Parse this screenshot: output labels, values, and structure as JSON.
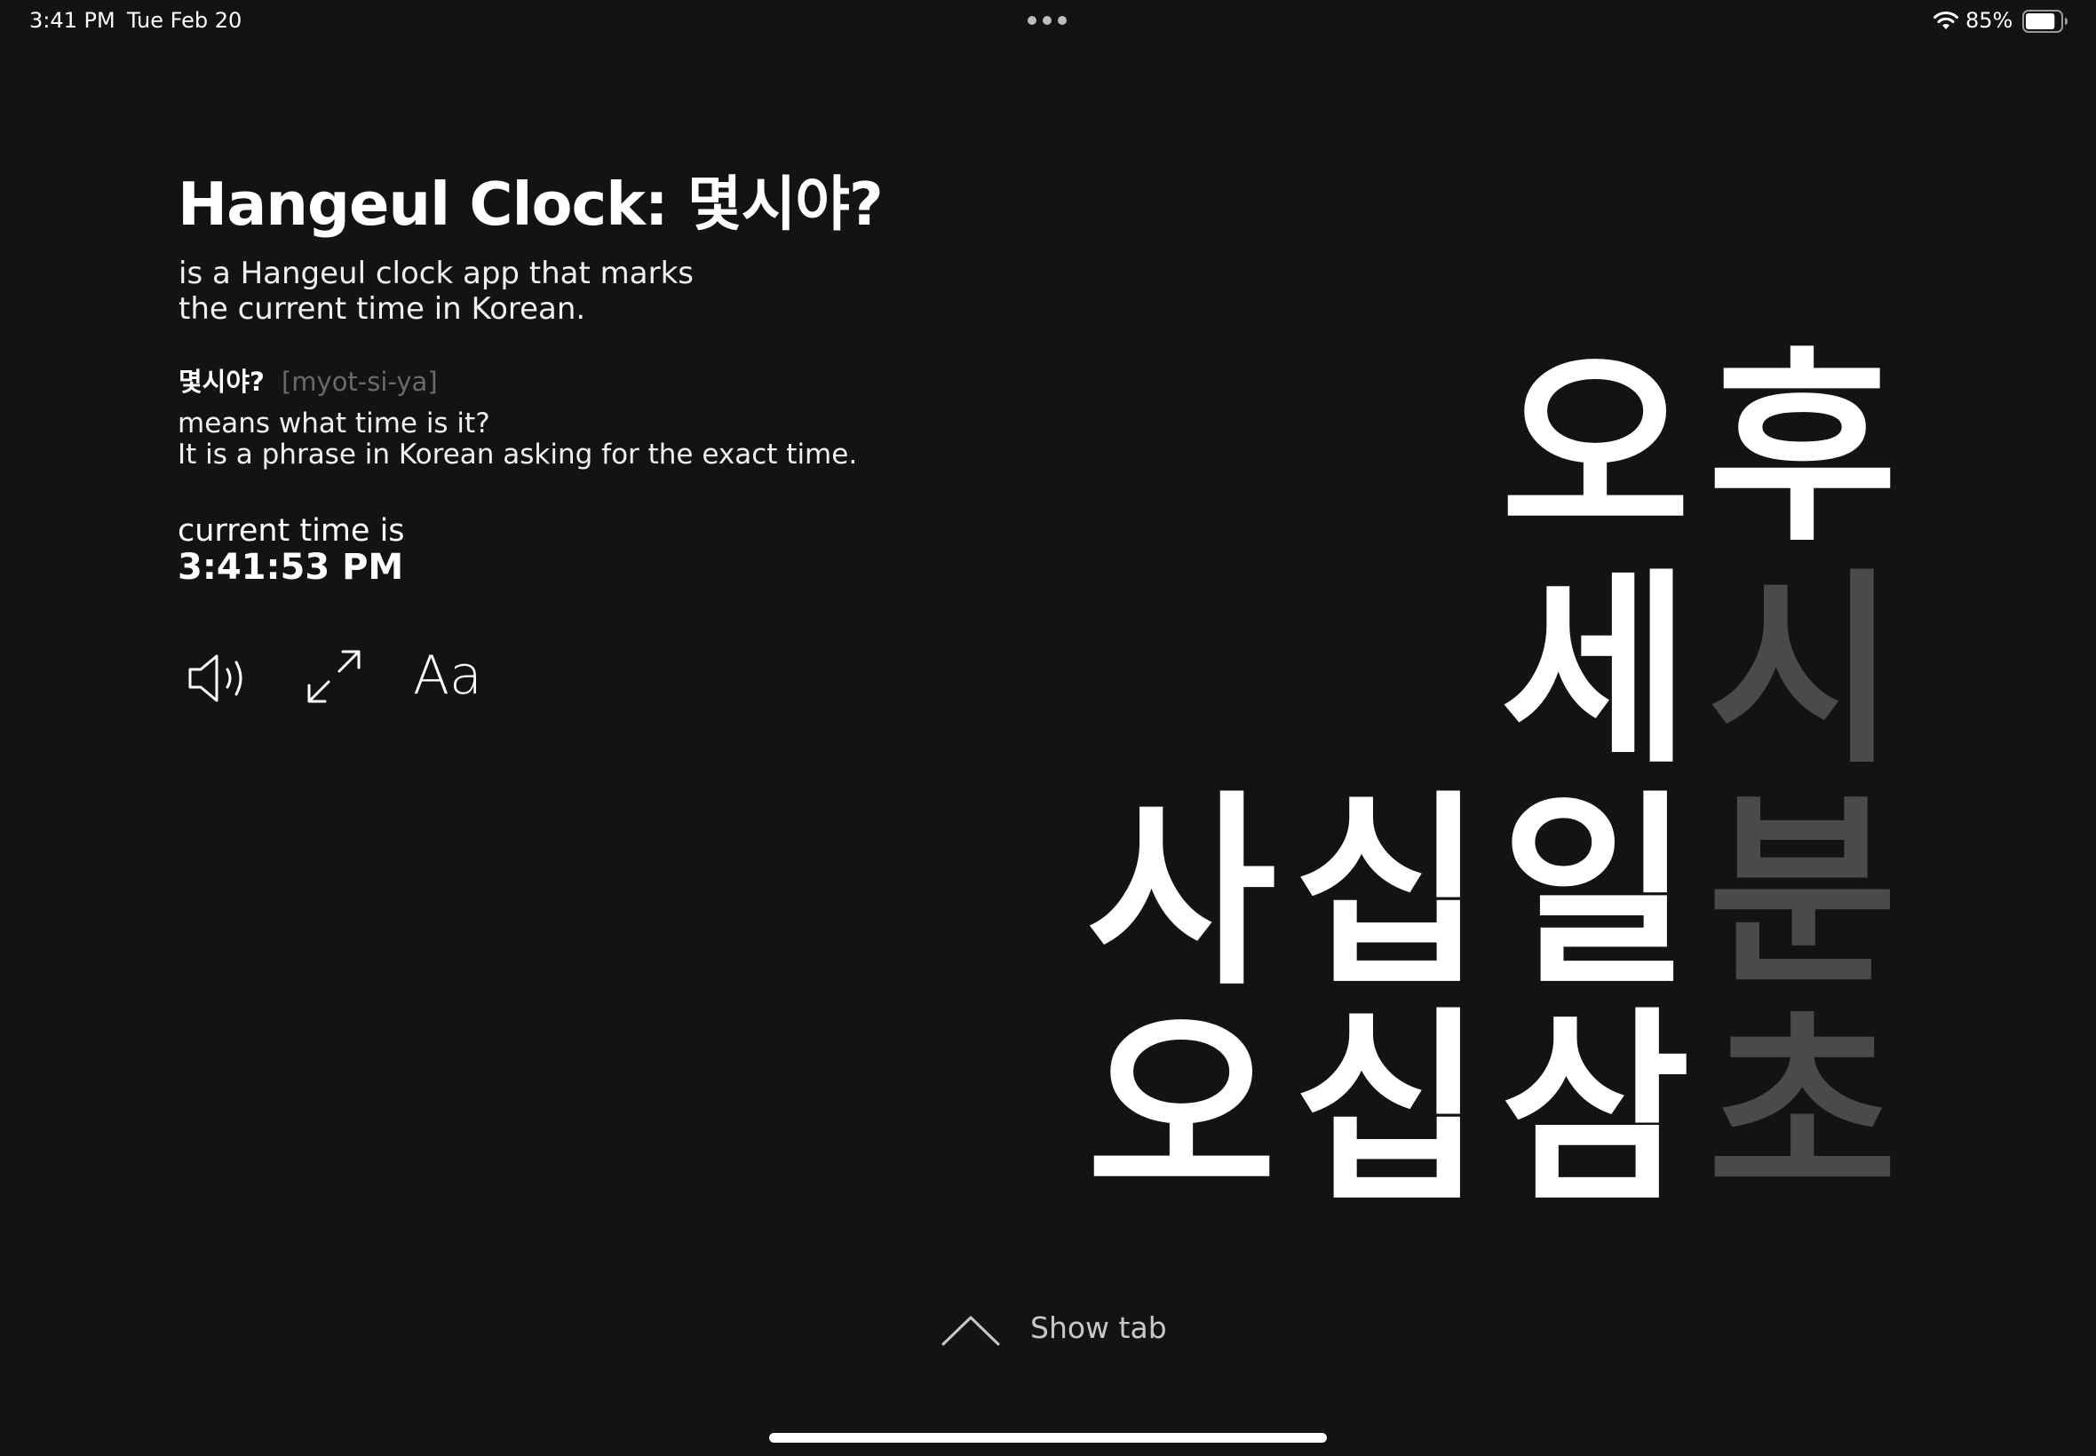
{
  "status_bar": {
    "time": "3:41 PM",
    "date": "Tue Feb 20",
    "battery_percent": "85%",
    "battery_level": 0.85,
    "icons": [
      "wifi-icon",
      "battery-icon",
      "multitask-dots-icon"
    ]
  },
  "info": {
    "title": "Hangeul Clock: 몇시야?",
    "description_lines": [
      "is a Hangeul clock app that marks",
      "the current time in Korean."
    ],
    "phrase": "몇시야?",
    "romanization": "[myot-si-ya]",
    "meaning_lines": [
      "means what time is it?",
      "It is a phrase in Korean asking for the exact time."
    ],
    "current_time_label": "current time is",
    "current_time_value": "3:41:53 PM"
  },
  "controls": {
    "sound_icon": "speaker-icon",
    "fullscreen_icon": "expand-icon",
    "font_label": "Aa"
  },
  "clock": {
    "ampm": [
      {
        "char": "오",
        "lit": true
      },
      {
        "char": "후",
        "lit": true
      }
    ],
    "hour": [
      {
        "char": "세",
        "lit": true
      },
      {
        "char": "시",
        "lit": false
      }
    ],
    "minute": [
      {
        "char": "사",
        "lit": true
      },
      {
        "char": "십",
        "lit": true
      },
      {
        "char": "일",
        "lit": true
      },
      {
        "char": "분",
        "lit": false
      }
    ],
    "second": [
      {
        "char": "오",
        "lit": true
      },
      {
        "char": "십",
        "lit": true
      },
      {
        "char": "삼",
        "lit": true
      },
      {
        "char": "초",
        "lit": false
      }
    ]
  },
  "bottom": {
    "show_tab_label": "Show tab",
    "show_tab_icon": "chevron-up-icon"
  },
  "colors": {
    "background": "#131313",
    "lit_text": "#ffffff",
    "dim_text": "#4a4a4a",
    "romanization": "#6a6a6a"
  }
}
